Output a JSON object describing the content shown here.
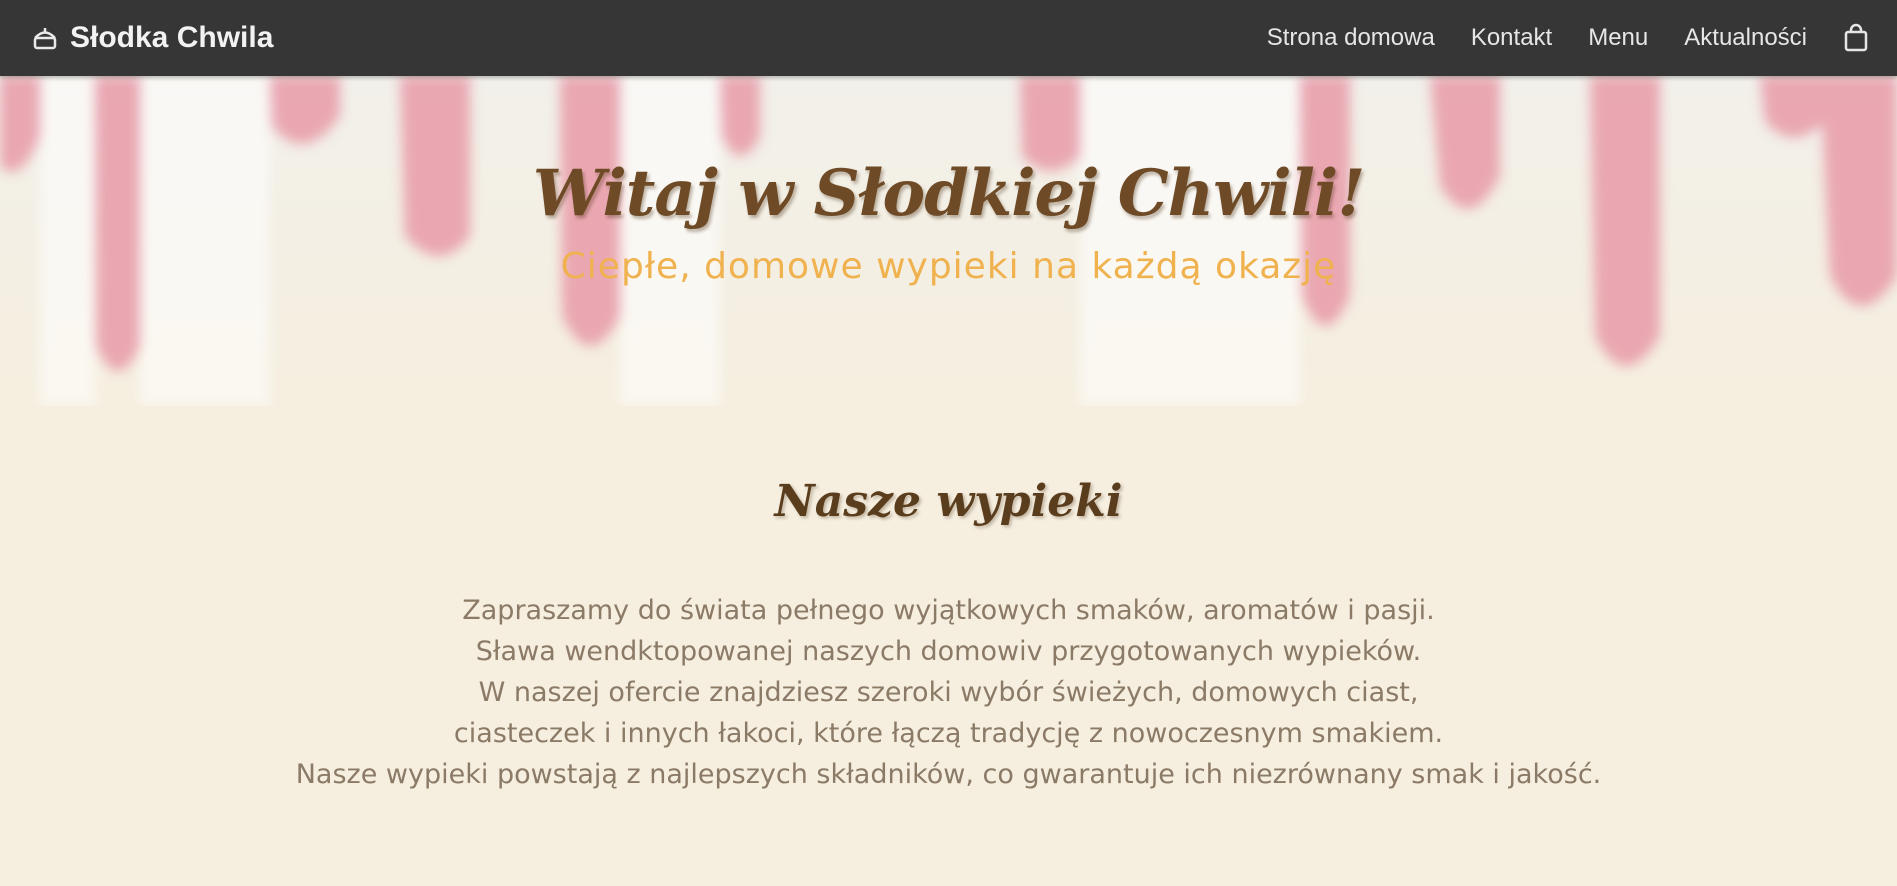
{
  "navbar": {
    "brand": "Słodka Chwila",
    "brand_icon": "cake-icon",
    "links": [
      "Strona domowa",
      "Kontakt",
      "Menu",
      "Aktualności"
    ],
    "cart_icon": "shopping-bag-icon",
    "background": "#363636"
  },
  "hero": {
    "title": "Witaj w Słodkiej Chwili!",
    "subtitle": "Ciepłe, domowe wypieki na każdą okazję",
    "title_color": "#6e4b26",
    "subtitle_color": "#f0b24e",
    "drip_color": "#e89aa8"
  },
  "main": {
    "section_title": "Nasze wypieki",
    "description_lines": [
      "Zapraszamy do świata pełnego wyjątkowych smaków, aromatów i pasji.",
      "Sława wendktopowanej naszych domowiv przygotowanych wypieków.",
      "W naszej ofercie znajdziesz szeroki wybór świeżych, domowych ciast,",
      "ciasteczek i innych łakoci, które łączą tradycję z nowoczesnym smakiem.",
      "Nasze wypieki powstają z najlepszych składników, co gwarantuje ich niezrównany smak i jakość."
    ],
    "background": "#f6efe0"
  }
}
